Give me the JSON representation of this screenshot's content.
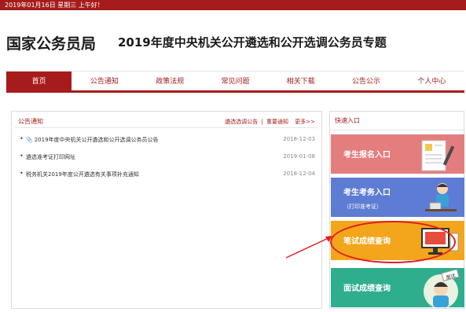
{
  "topbar": {
    "date_text": "2019年01月16日  星期三  上午好！"
  },
  "header": {
    "site_title": "国家公务员局",
    "special_title": "2019年度中央机关公开遴选和公开选调公务员专题"
  },
  "nav": {
    "items": [
      {
        "label": "首页"
      },
      {
        "label": "公告通知"
      },
      {
        "label": "政策法规"
      },
      {
        "label": "常见问题"
      },
      {
        "label": "相关下载"
      },
      {
        "label": "公告公示"
      },
      {
        "label": "个人中心"
      }
    ]
  },
  "notices": {
    "title": "公告通知",
    "link_1": "遴选选调公告",
    "separator": "|",
    "link_2": "重要通知",
    "more": "更多>>",
    "items": [
      {
        "text": "2019年度中央机关公开遴选和公开选调公务员公告",
        "date": "2018-12-03"
      },
      {
        "text": "遴选准考证打印网址",
        "date": "2019-01-08"
      },
      {
        "text": "税务机关2019年度公开遴选有关事项补充通知",
        "date": "2018-12-04"
      }
    ]
  },
  "quick": {
    "title": "快速入口",
    "entries": [
      {
        "label": "考生报名入口",
        "sub": ""
      },
      {
        "label": "考生考务入口",
        "sub": "（打印准考证）"
      },
      {
        "label": "笔试成绩查询",
        "sub": ""
      },
      {
        "label": "面试成绩查询",
        "sub": "面试"
      }
    ]
  },
  "colors": {
    "brand_red": "#a61c1c",
    "entry1": "#e47e7e",
    "entry2": "#5d7cd3",
    "entry3": "#f3a51b",
    "entry4": "#2fae8e",
    "annotation": "#e01f1f"
  }
}
